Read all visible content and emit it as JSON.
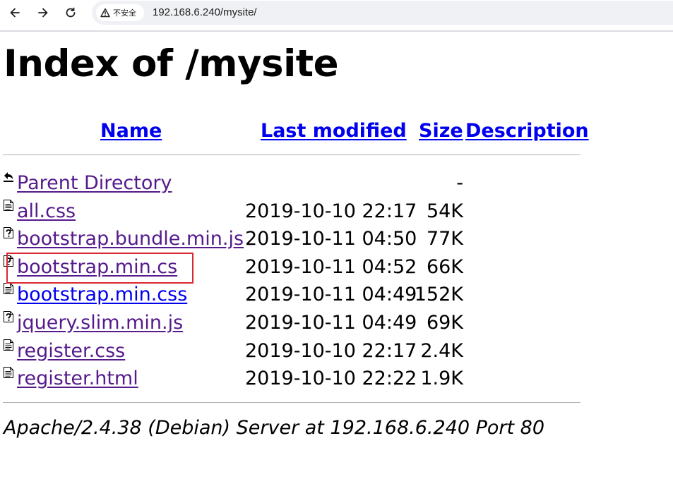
{
  "browser": {
    "security_label": "不安全",
    "url": "192.168.6.240/mysite/"
  },
  "page": {
    "title": "Index of /mysite",
    "headers": {
      "name": "Name",
      "last_modified": "Last modified",
      "size": "Size",
      "description": "Description"
    },
    "rows": [
      {
        "name": "Parent Directory",
        "modified": "",
        "size": "-",
        "icon": "back-icon",
        "visited": true
      },
      {
        "name": "all.css",
        "modified": "2019-10-10 22:17",
        "size": "54K",
        "icon": "text-file-icon",
        "visited": true
      },
      {
        "name": "bootstrap.bundle.min.js",
        "modified": "2019-10-11 04:50",
        "size": "77K",
        "icon": "unknown-file-icon",
        "visited": true
      },
      {
        "name": "bootstrap.min.cs",
        "modified": "2019-10-11 04:52",
        "size": "66K",
        "icon": "unknown-file-icon",
        "visited": true
      },
      {
        "name": "bootstrap.min.css",
        "modified": "2019-10-11 04:49",
        "size": "152K",
        "icon": "text-file-icon",
        "visited": false
      },
      {
        "name": "jquery.slim.min.js",
        "modified": "2019-10-11 04:49",
        "size": "69K",
        "icon": "unknown-file-icon",
        "visited": true
      },
      {
        "name": "register.css",
        "modified": "2019-10-10 22:17",
        "size": "2.4K",
        "icon": "text-file-icon",
        "visited": true
      },
      {
        "name": "register.html",
        "modified": "2019-10-10 22:22",
        "size": "1.9K",
        "icon": "text-file-icon",
        "visited": true
      }
    ],
    "footer": "Apache/2.4.38 (Debian) Server at 192.168.6.240 Port 80"
  },
  "colors": {
    "link": "#0000ee",
    "visited_link": "#551a8b",
    "highlight": "#d9282f"
  }
}
